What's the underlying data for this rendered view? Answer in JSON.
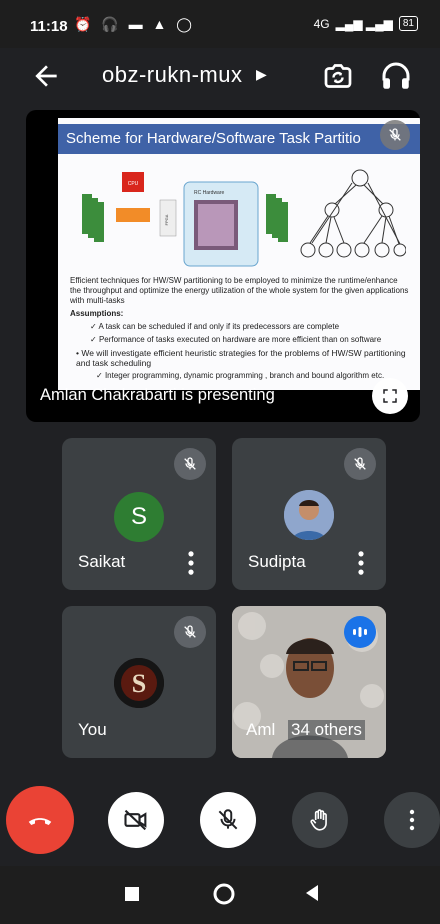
{
  "status_bar": {
    "time": "11:18",
    "icons": [
      "alarm-icon",
      "headset-icon",
      "message-icon",
      "warning-icon",
      "whatsapp-icon"
    ],
    "network": "4G",
    "battery": "81"
  },
  "header": {
    "meeting_code": "obz-rukn-mux"
  },
  "presentation": {
    "slide_title": "Scheme for Hardware/Software Task Partitio",
    "diagram_labels": {
      "cpu": "CPU",
      "rc": "RC Hardware",
      "fpga": "FPGA"
    },
    "slide_body": "Efficient techniques for HW/SW partitioning to be employed to minimize the runtime/enhance the throughput and optimize the energy utilization of the whole system for the given applications with multi-tasks",
    "assumptions_label": "Assumptions:",
    "assumption_items": [
      "A task can be scheduled if and only if its predecessors are complete",
      "Performance of tasks executed on hardware are more efficient than on software"
    ],
    "bullet": "We will investigate efficient heuristic strategies for the problems of HW/SW partitioning and task scheduling",
    "sub_bullet": "Integer programming, dynamic programming , branch and bound algorithm etc.",
    "presenter_label": "Amlan Chakrabarti is presenting"
  },
  "participants": [
    {
      "name": "Saikat",
      "avatar_letter": "S",
      "avatar_color": "#2e7d32"
    },
    {
      "name": "Sudipta"
    },
    {
      "name": "You"
    },
    {
      "name": "Aml",
      "overflow": "34 others"
    }
  ],
  "colors": {
    "end_call": "#ea4335",
    "speaking": "#1a73e8",
    "tile": "#3c4043"
  }
}
